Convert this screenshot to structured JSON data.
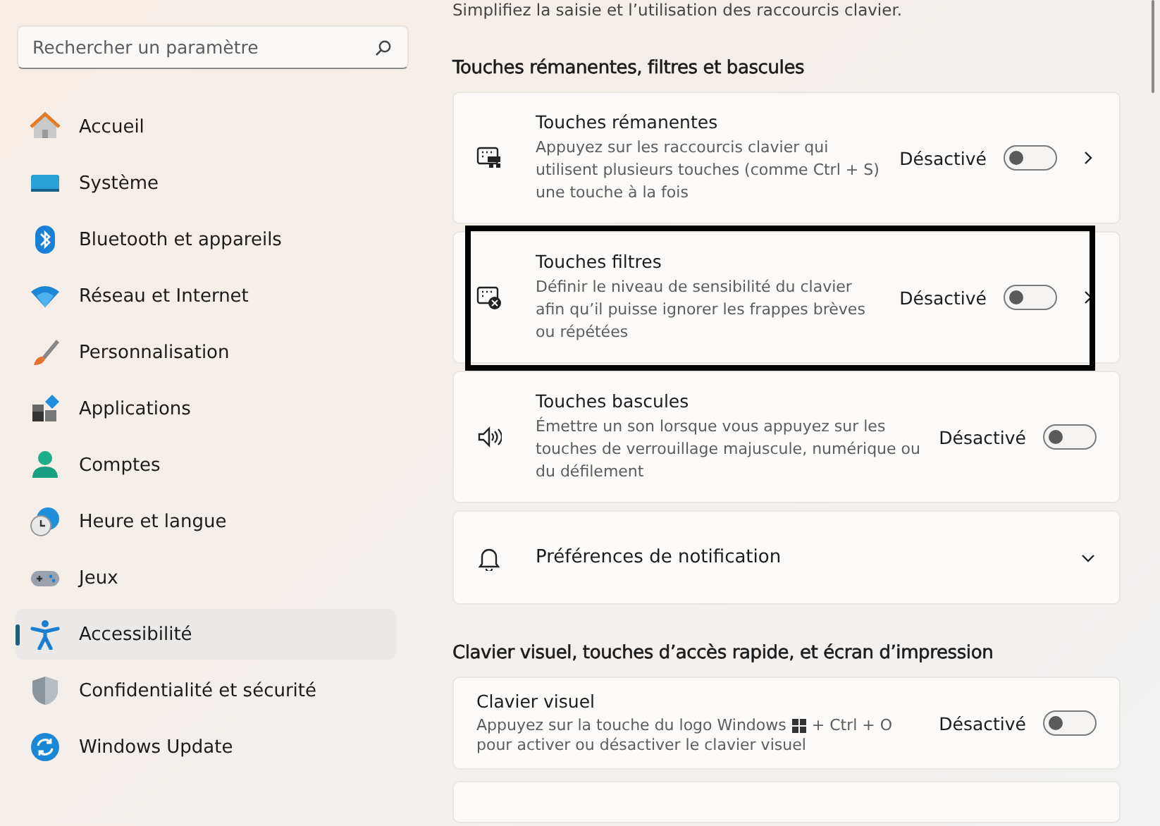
{
  "search": {
    "placeholder": "Rechercher un paramètre"
  },
  "sidebar": {
    "items": [
      {
        "label": "Accueil",
        "selected": false
      },
      {
        "label": "Système",
        "selected": false
      },
      {
        "label": "Bluetooth et appareils",
        "selected": false
      },
      {
        "label": "Réseau et Internet",
        "selected": false
      },
      {
        "label": "Personnalisation",
        "selected": false
      },
      {
        "label": "Applications",
        "selected": false
      },
      {
        "label": "Comptes",
        "selected": false
      },
      {
        "label": "Heure et langue",
        "selected": false
      },
      {
        "label": "Jeux",
        "selected": false
      },
      {
        "label": "Accessibilité",
        "selected": true
      },
      {
        "label": "Confidentialité et sécurité",
        "selected": false
      },
      {
        "label": "Windows Update",
        "selected": false
      }
    ]
  },
  "page": {
    "intro": "Simplifiez la saisie et l’utilisation des raccourcis clavier.",
    "sections": [
      {
        "heading": "Touches rémanentes, filtres et bascules",
        "settings": [
          {
            "kind": "toggle_link",
            "title": "Touches rémanentes",
            "description": "Appuyez sur les raccourcis clavier qui utilisent plusieurs touches (comme Ctrl + S) une touche à la fois",
            "state_label": "Désactivé",
            "on": false,
            "highlighted": false
          },
          {
            "kind": "toggle_link",
            "title": "Touches filtres",
            "description": "Définir le niveau de sensibilité du clavier afin qu’il puisse ignorer les frappes brèves ou répétées",
            "state_label": "Désactivé",
            "on": false,
            "highlighted": true
          },
          {
            "kind": "toggle",
            "title": "Touches bascules",
            "description": "Émettre un son lorsque vous appuyez sur les touches de verrouillage majuscule, numérique ou du défilement",
            "state_label": "Désactivé",
            "on": false,
            "highlighted": false
          },
          {
            "kind": "expander",
            "title": "Préférences de notification",
            "expanded": false,
            "highlighted": false
          }
        ]
      },
      {
        "heading": "Clavier visuel, touches d’accès rapide, et écran d’impression",
        "settings": [
          {
            "kind": "toggle_plain",
            "title": "Clavier visuel",
            "description_parts": [
              "Appuyez sur la touche du logo Windows",
              "+ Ctrl + O",
              "pour activer ou désactiver le clavier visuel"
            ],
            "state_label": "Désactivé",
            "on": false,
            "highlighted": false
          }
        ]
      }
    ]
  }
}
